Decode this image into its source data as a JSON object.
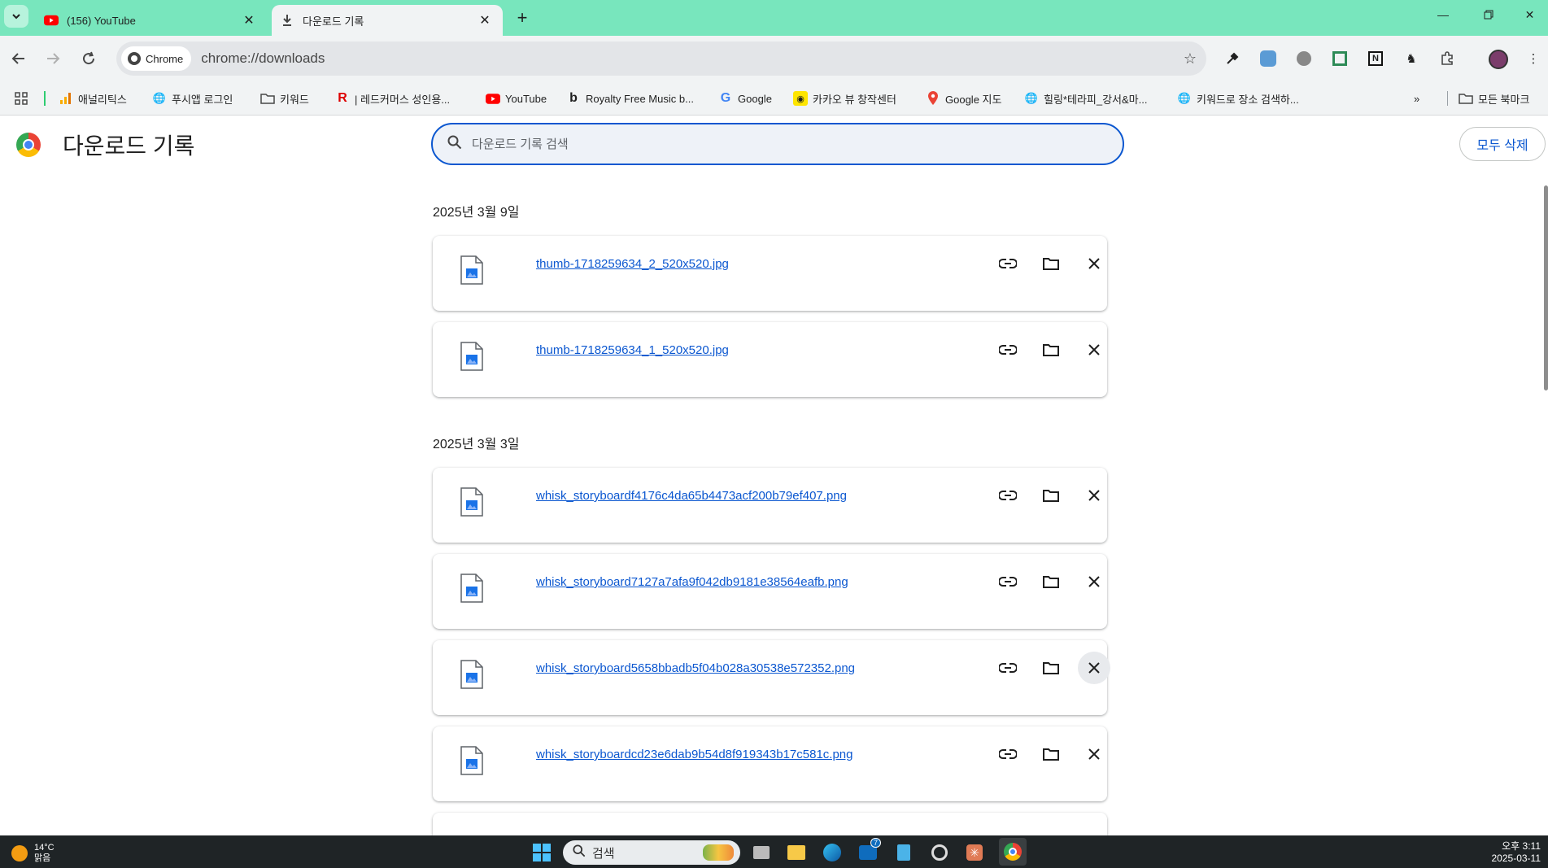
{
  "tabs": [
    {
      "title": "(156) YouTube",
      "active": false
    },
    {
      "title": "다운로드 기록",
      "active": true
    }
  ],
  "toolbar": {
    "chip_label": "Chrome",
    "url": "chrome://downloads"
  },
  "bookmarks": [
    {
      "label": "애널리틱스",
      "icon": "analytics-icon"
    },
    {
      "label": "푸시앱 로그인",
      "icon": "globe-icon"
    },
    {
      "label": "키워드",
      "icon": "folder-icon"
    },
    {
      "label": "| 레드커머스 성인용...",
      "icon": "r-logo-icon"
    },
    {
      "label": "YouTube",
      "icon": "youtube-icon"
    },
    {
      "label": "Royalty Free Music b...",
      "icon": "b-logo-icon"
    },
    {
      "label": "Google",
      "icon": "google-icon"
    },
    {
      "label": "카카오 뷰 창작센터",
      "icon": "kakao-icon"
    },
    {
      "label": "Google 지도",
      "icon": "maps-icon"
    },
    {
      "label": "힐링*테라피_강서&마...",
      "icon": "globe-icon"
    },
    {
      "label": "키워드로 장소 검색하...",
      "icon": "globe-icon"
    }
  ],
  "all_bookmarks": "모든 북마크",
  "page": {
    "title": "다운로드 기록",
    "search_placeholder": "다운로드 기록 검색",
    "clear_all": "모두 삭제"
  },
  "groups": [
    {
      "date": "2025년 3월 9일",
      "items": [
        {
          "name": "thumb-1718259634_2_520x520.jpg"
        },
        {
          "name": "thumb-1718259634_1_520x520.jpg"
        }
      ]
    },
    {
      "date": "2025년 3월 3일",
      "items": [
        {
          "name": "whisk_storyboardf4176c4da65b4473acf200b79ef407.png"
        },
        {
          "name": "whisk_storyboard7127a7afa9f042db9181e38564eafb.png"
        },
        {
          "name": "whisk_storyboard5658bbadb5f04b028a30538e572352.png"
        },
        {
          "name": "whisk_storyboardcd23e6dab9b54d8f919343b17c581c.png"
        }
      ]
    }
  ],
  "taskbar": {
    "temp": "14°C",
    "weather": "맑음",
    "search": "검색",
    "mail_badge": "7",
    "time": "오후 3:11",
    "date": "2025-03-11"
  },
  "colors": {
    "tabstrip": "#78e6bd",
    "accent": "#0b57d0"
  }
}
